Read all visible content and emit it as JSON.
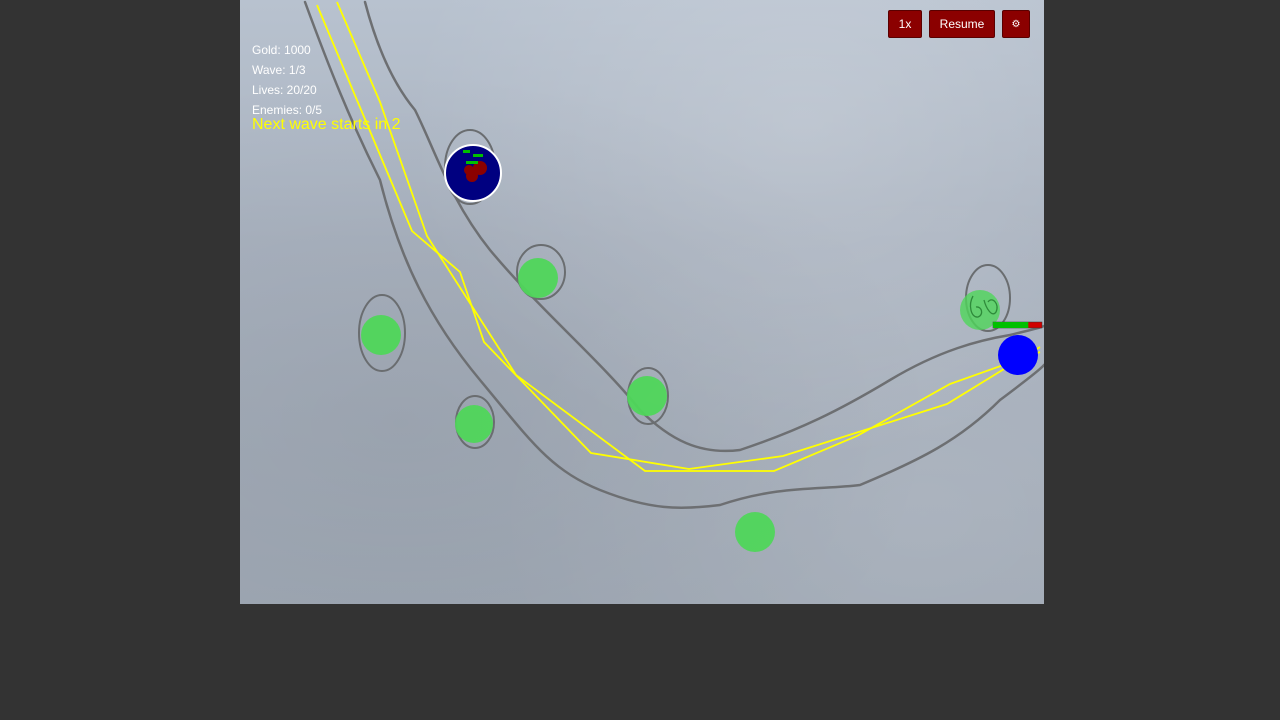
{
  "hud": {
    "gold": "Gold: 1000",
    "wave": "Wave: 1/3",
    "lives": "Lives: 20/20",
    "enemies": "Enemies: 0/5"
  },
  "wave_message": "Next wave starts in 2",
  "controls": {
    "speed_label": "1x",
    "resume_label": "Resume",
    "settings_label": "⚙"
  },
  "colors": {
    "background": "#333333",
    "button": "#8b0000",
    "path": "#ffff00",
    "tower_spot": "#4fd65a",
    "tower_base": "#000080",
    "enemy": "#0000ff",
    "health_good": "#00c000",
    "health_bad": "#d00000"
  },
  "icons": {
    "settings": "gear-icon"
  },
  "enemy": {
    "health_fraction": 0.72
  }
}
